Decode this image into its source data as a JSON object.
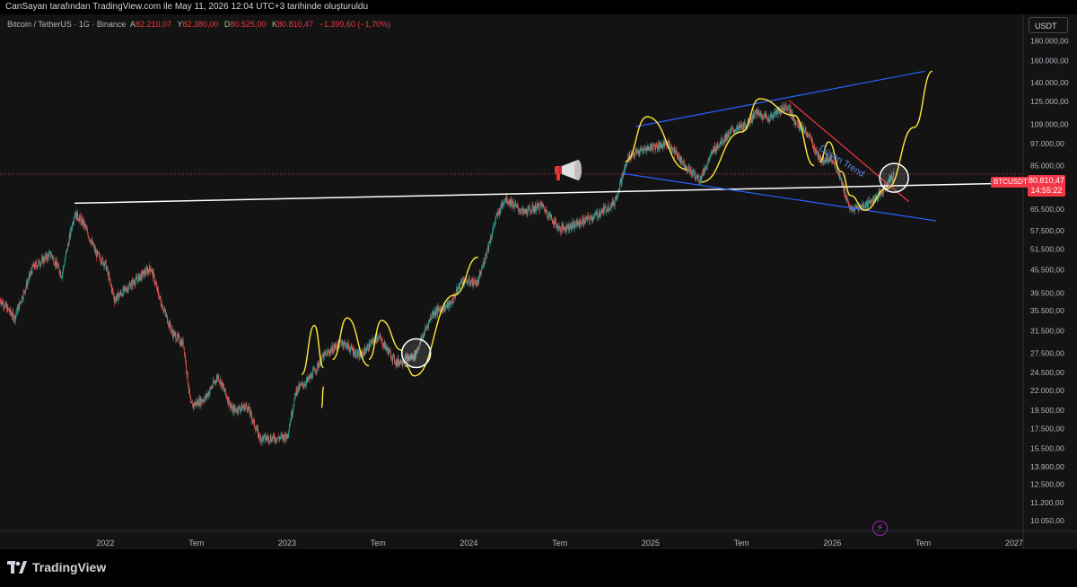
{
  "attribution": "CanSayan tarafından TradingView.com ile May 11, 2026 12:04 UTC+3 tarihinde oluşturuldu",
  "symbol": {
    "name": "Bitcoin / TetherUS · 1G · Binance",
    "open_label": "A",
    "open": "82.210,07",
    "high_label": "Y",
    "high": "82.380,00",
    "low_label": "D",
    "low": "80.525,00",
    "close_label": "K",
    "close": "80.810,47",
    "change": "−1.399,60 (−1,70%)"
  },
  "currency": "USDT",
  "price_tag": {
    "ticker": "BTCUSDT",
    "price": "80.810,47",
    "countdown": "14:55:22"
  },
  "annotation": "Düşen Trend",
  "footer": {
    "logo_text": "TradingView"
  },
  "icons": [
    "megaphone-icon",
    "tradingview-logo-icon",
    "lightning-icon"
  ],
  "colors": {
    "up": "#26a69a",
    "down": "#ef5350",
    "trendline": "#2962ff",
    "arc": "#ffeb3b",
    "support": "#ffffff",
    "downtrend": "#f23645",
    "price_tag": "#f23645"
  },
  "chart_data": {
    "type": "candlestick",
    "y_scale": "log",
    "ylim": [
      10050,
      200000
    ],
    "y_ticks": [
      {
        "label": "180.000,00",
        "v": 180000
      },
      {
        "label": "160.000,00",
        "v": 160000
      },
      {
        "label": "140.000,00",
        "v": 140000
      },
      {
        "label": "125.000,00",
        "v": 125000
      },
      {
        "label": "109.000,00",
        "v": 109000
      },
      {
        "label": "97.000,00",
        "v": 97000
      },
      {
        "label": "85.000,00",
        "v": 85000
      },
      {
        "label": "73.000,00",
        "v": 73000
      },
      {
        "label": "65.500,00",
        "v": 65500
      },
      {
        "label": "57.500,00",
        "v": 57500
      },
      {
        "label": "51.500,00",
        "v": 51500
      },
      {
        "label": "45.500,00",
        "v": 45500
      },
      {
        "label": "39.500,00",
        "v": 39500
      },
      {
        "label": "35.500,00",
        "v": 35500
      },
      {
        "label": "31.500,00",
        "v": 31500
      },
      {
        "label": "27.500,00",
        "v": 27500
      },
      {
        "label": "24.500,00",
        "v": 24500
      },
      {
        "label": "22.000,00",
        "v": 22000
      },
      {
        "label": "19.500,00",
        "v": 19500
      },
      {
        "label": "17.500,00",
        "v": 17500
      },
      {
        "label": "15.500,00",
        "v": 15500
      },
      {
        "label": "13.900,00",
        "v": 13900
      },
      {
        "label": "12.500,00",
        "v": 12500
      },
      {
        "label": "11.200,00",
        "v": 11200
      },
      {
        "label": "10.050,00",
        "v": 10050
      }
    ],
    "x_ticks": [
      {
        "label": "2022",
        "t": 2022.0
      },
      {
        "label": "Tem",
        "t": 2022.5
      },
      {
        "label": "2023",
        "t": 2023.0
      },
      {
        "label": "Tem",
        "t": 2023.5
      },
      {
        "label": "2024",
        "t": 2024.0
      },
      {
        "label": "Tem",
        "t": 2024.5
      },
      {
        "label": "2025",
        "t": 2025.0
      },
      {
        "label": "Tem",
        "t": 2025.5
      },
      {
        "label": "2026",
        "t": 2026.0
      },
      {
        "label": "Tem",
        "t": 2026.5
      },
      {
        "label": "2027",
        "t": 2027.0
      }
    ],
    "xlim": [
      2021.42,
      2027.05
    ],
    "last_price": 80810.47,
    "price_path": [
      [
        2021.42,
        38000
      ],
      [
        2021.5,
        34000
      ],
      [
        2021.6,
        46000
      ],
      [
        2021.7,
        50000
      ],
      [
        2021.76,
        44000
      ],
      [
        2021.83,
        64000
      ],
      [
        2021.88,
        60000
      ],
      [
        2021.95,
        50000
      ],
      [
        2022.0,
        47000
      ],
      [
        2022.05,
        38000
      ],
      [
        2022.15,
        42000
      ],
      [
        2022.25,
        46000
      ],
      [
        2022.3,
        38000
      ],
      [
        2022.37,
        31000
      ],
      [
        2022.43,
        29000
      ],
      [
        2022.47,
        20000
      ],
      [
        2022.55,
        21000
      ],
      [
        2022.62,
        24000
      ],
      [
        2022.7,
        19500
      ],
      [
        2022.78,
        20000
      ],
      [
        2022.85,
        16500
      ],
      [
        2022.95,
        16500
      ],
      [
        2023.0,
        16700
      ],
      [
        2023.05,
        22000
      ],
      [
        2023.12,
        23500
      ],
      [
        2023.2,
        27000
      ],
      [
        2023.3,
        29500
      ],
      [
        2023.4,
        27000
      ],
      [
        2023.5,
        30500
      ],
      [
        2023.6,
        26000
      ],
      [
        2023.7,
        27000
      ],
      [
        2023.8,
        35000
      ],
      [
        2023.9,
        37000
      ],
      [
        2023.96,
        42500
      ],
      [
        2024.05,
        42000
      ],
      [
        2024.15,
        62000
      ],
      [
        2024.2,
        70000
      ],
      [
        2024.3,
        64000
      ],
      [
        2024.4,
        67000
      ],
      [
        2024.5,
        58000
      ],
      [
        2024.6,
        60000
      ],
      [
        2024.7,
        63000
      ],
      [
        2024.8,
        68000
      ],
      [
        2024.88,
        90000
      ],
      [
        2025.0,
        95000
      ],
      [
        2025.1,
        97000
      ],
      [
        2025.2,
        84000
      ],
      [
        2025.27,
        78000
      ],
      [
        2025.35,
        94000
      ],
      [
        2025.45,
        105000
      ],
      [
        2025.52,
        108000
      ],
      [
        2025.58,
        117000
      ],
      [
        2025.65,
        113000
      ],
      [
        2025.75,
        122000
      ],
      [
        2025.8,
        110000
      ],
      [
        2025.87,
        102000
      ],
      [
        2025.93,
        88000
      ],
      [
        2026.0,
        89000
      ],
      [
        2026.05,
        77000
      ],
      [
        2026.1,
        65000
      ],
      [
        2026.18,
        67000
      ],
      [
        2026.26,
        71000
      ],
      [
        2026.34,
        80810
      ]
    ],
    "drawings": [
      {
        "name": "horizontal-support-line",
        "kind": "line",
        "points": [
          [
            2021.83,
            67800
          ],
          [
            2027.02,
            76500
          ]
        ]
      },
      {
        "name": "channel-upper-line",
        "kind": "line",
        "points": [
          [
            2024.92,
            107500
          ],
          [
            2026.51,
            150000
          ]
        ]
      },
      {
        "name": "channel-lower-line",
        "kind": "line",
        "points": [
          [
            2024.85,
            81000
          ],
          [
            2026.57,
            61000
          ]
        ]
      },
      {
        "name": "downtrend-line",
        "kind": "line",
        "points": [
          [
            2025.76,
            126000
          ],
          [
            2026.42,
            68500
          ]
        ]
      }
    ],
    "circles": [
      {
        "name": "highlight-circle-2023",
        "t": 2023.71,
        "v": 27500
      },
      {
        "name": "highlight-circle-2026",
        "t": 2026.34,
        "v": 79000
      }
    ]
  }
}
